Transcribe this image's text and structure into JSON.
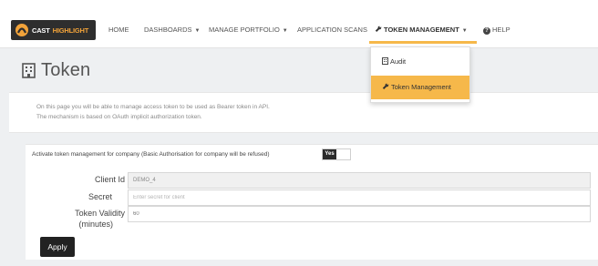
{
  "brand": {
    "part1": "CAST",
    "part2": "HIGHLIGHT"
  },
  "nav": {
    "home": "HOME",
    "dashboards": "DASHBOARDS",
    "manage_portfolio": "MANAGE PORTFOLIO",
    "application_scans": "APPLICATION SCANS",
    "token_management": "TOKEN MANAGEMENT",
    "help": "HELP"
  },
  "dropdown": {
    "items": [
      {
        "label": "Audit",
        "icon": "building-icon"
      },
      {
        "label": "Token Management",
        "icon": "wrench-icon",
        "active": true
      }
    ]
  },
  "page": {
    "title": "Token",
    "intro_line1": "On this page you will be able to manage access token to be used as Bearer token in API.",
    "intro_line2": "The mechanism is based on OAuth implicit authorization token."
  },
  "form": {
    "activate_label": "Activate token management for company (Basic Authorisation for company will be refused)",
    "toggle_value": "Yes",
    "client_id_label": "Client Id",
    "client_id_value": "DEMO_4",
    "secret_label": "Secret",
    "secret_placeholder": "Enter secret for client",
    "validity_label_line1": "Token Validity",
    "validity_label_line2": "(minutes)",
    "validity_value": "60",
    "apply_label": "Apply"
  },
  "colors": {
    "accent": "#f6b84a",
    "dark": "#222222"
  }
}
